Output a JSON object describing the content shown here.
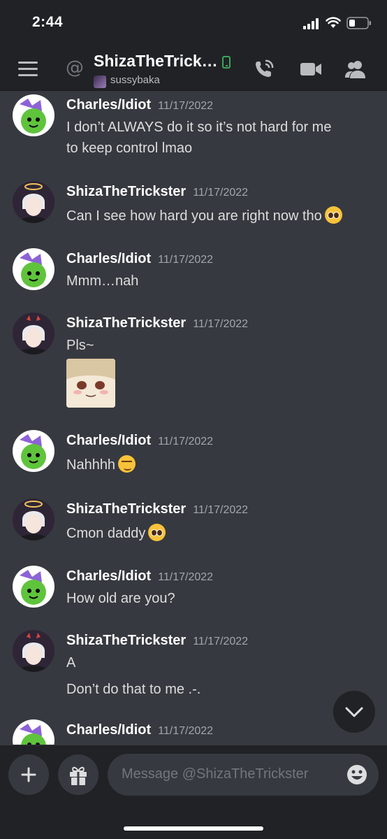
{
  "status_bar": {
    "time": "2:44"
  },
  "header": {
    "title": "ShizaTheTrick…",
    "status": "sussybaka"
  },
  "messages": [
    {
      "author": "Charles/Idiot",
      "time": "11/17/2022",
      "lines": [
        "I don’t ALWAYS do it so it’s not hard for me",
        "to keep control lmao"
      ]
    },
    {
      "author": "ShizaTheTrickster",
      "time": "11/17/2022",
      "lines": [
        "Can I see how hard you are right now tho"
      ]
    },
    {
      "author": "Charles/Idiot",
      "time": "11/17/2022",
      "lines": [
        "Mmm…nah"
      ]
    },
    {
      "author": "ShizaTheTrickster",
      "time": "11/17/2022",
      "lines": [
        "Pls~"
      ]
    },
    {
      "author": "Charles/Idiot",
      "time": "11/17/2022",
      "lines": [
        "Nahhhh"
      ]
    },
    {
      "author": "ShizaTheTrickster",
      "time": "11/17/2022",
      "lines": [
        "Cmon daddy"
      ]
    },
    {
      "author": "Charles/Idiot",
      "time": "11/17/2022",
      "lines": [
        "How old are you?"
      ]
    },
    {
      "author": "ShizaTheTrickster",
      "time": "11/17/2022",
      "lines": [
        "A",
        "Don’t do that to me .-."
      ]
    },
    {
      "author": "Charles/Idiot",
      "time": "11/17/2022",
      "lines": []
    }
  ],
  "composer": {
    "placeholder": "Message @ShizaTheTrickster"
  },
  "icons": {
    "menu": "menu-icon",
    "call": "phone-call-icon",
    "video": "video-camera-icon",
    "members": "members-icon",
    "add": "plus-icon",
    "gift": "gift-icon",
    "emoji": "emoji-icon",
    "jump": "chevron-down-icon"
  },
  "colors": {
    "background": "#36393f",
    "bars": "#202225",
    "online_mobile": "#3ba55c",
    "author": "#ffffff",
    "timestamp": "#a3a6aa",
    "text": "#dcddde"
  }
}
